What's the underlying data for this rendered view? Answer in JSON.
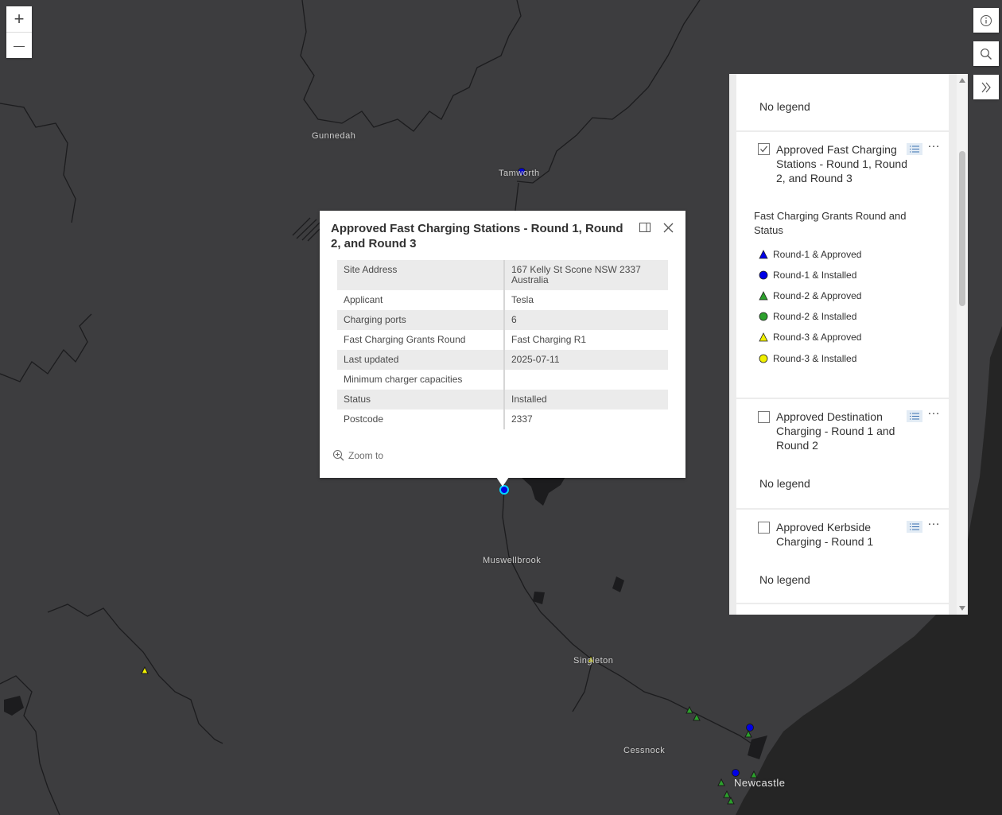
{
  "cities": [
    "Gunnedah",
    "Tamworth",
    "Muswellbrook",
    "Singleton",
    "Cessnock",
    "Newcastle"
  ],
  "map_controls": {
    "zoom_in": "+",
    "zoom_out": "—"
  },
  "colors": {
    "map_bg": "#3d3d3f",
    "sea": "#252525",
    "river": "#1c1c1e",
    "round1": "#0000e6",
    "round2": "#2ca02c",
    "round3": "#f0f000"
  },
  "popup": {
    "title": "Approved Fast Charging Stations - Round 1, Round 2, and Round 3",
    "rows": [
      {
        "label": "Site Address",
        "value": "167 Kelly St Scone NSW 2337 Australia"
      },
      {
        "label": "Applicant",
        "value": "Tesla"
      },
      {
        "label": "Charging ports",
        "value": "6"
      },
      {
        "label": "Fast Charging Grants Round",
        "value": "Fast Charging R1"
      },
      {
        "label": "Last updated",
        "value": "2025-07-11"
      },
      {
        "label": "Minimum charger capacities",
        "value": ""
      },
      {
        "label": "Status",
        "value": "Installed"
      },
      {
        "label": "Postcode",
        "value": "2337"
      }
    ],
    "zoom_to": "Zoom to"
  },
  "legend": {
    "layers": [
      {
        "no_legend": "No legend"
      },
      {
        "title": "Approved Fast Charging Stations - Round 1, Round 2, and Round 3",
        "checked": true,
        "field": "Fast Charging Grants Round and Status",
        "items": [
          {
            "label": "Round-1 & Approved",
            "shape": "triangle",
            "color": "#0000e6"
          },
          {
            "label": "Round-1 & Installed",
            "shape": "circle",
            "color": "#0000e6"
          },
          {
            "label": "Round-2 & Approved",
            "shape": "triangle",
            "color": "#2ca02c"
          },
          {
            "label": "Round-2 & Installed",
            "shape": "circle",
            "color": "#2ca02c"
          },
          {
            "label": "Round-3 & Approved",
            "shape": "triangle",
            "color": "#f0f000"
          },
          {
            "label": "Round-3 & Installed",
            "shape": "circle",
            "color": "#f0f000"
          }
        ]
      },
      {
        "title": "Approved Destination Charging - Round 1 and Round 2",
        "checked": false,
        "no_legend": "No legend"
      },
      {
        "title": "Approved Kerbside Charging - Round 1",
        "checked": false,
        "no_legend": "No legend"
      }
    ]
  }
}
